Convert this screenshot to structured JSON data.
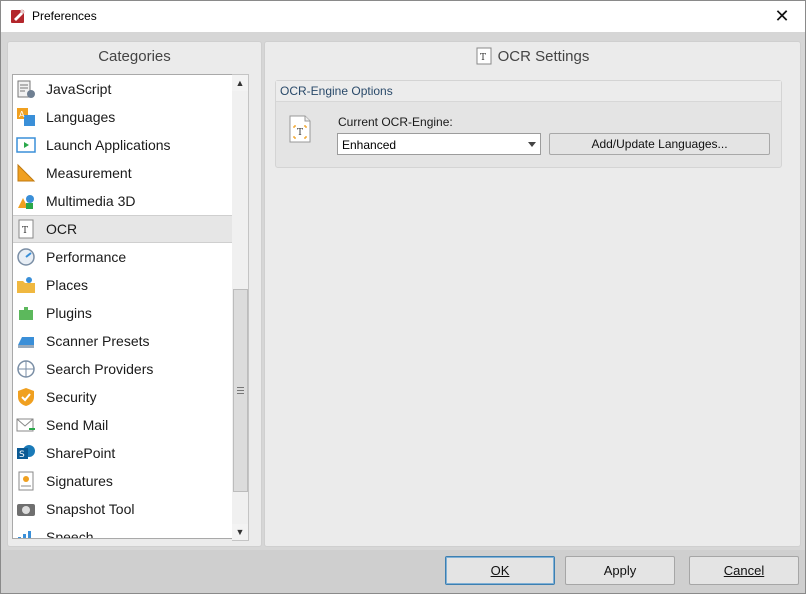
{
  "window": {
    "title": "Preferences",
    "close_glyph": "✕"
  },
  "categories": {
    "header": "Categories",
    "items": [
      {
        "label": "JavaScript",
        "icon": "javascript-icon"
      },
      {
        "label": "Languages",
        "icon": "languages-icon"
      },
      {
        "label": "Launch Applications",
        "icon": "launch-applications-icon"
      },
      {
        "label": "Measurement",
        "icon": "measurement-icon"
      },
      {
        "label": "Multimedia 3D",
        "icon": "multimedia-3d-icon"
      },
      {
        "label": "OCR",
        "icon": "ocr-icon",
        "selected": true
      },
      {
        "label": "Performance",
        "icon": "performance-icon"
      },
      {
        "label": "Places",
        "icon": "places-icon"
      },
      {
        "label": "Plugins",
        "icon": "plugins-icon"
      },
      {
        "label": "Scanner Presets",
        "icon": "scanner-presets-icon"
      },
      {
        "label": "Search Providers",
        "icon": "search-providers-icon"
      },
      {
        "label": "Security",
        "icon": "security-icon"
      },
      {
        "label": "Send Mail",
        "icon": "send-mail-icon"
      },
      {
        "label": "SharePoint",
        "icon": "sharepoint-icon"
      },
      {
        "label": "Signatures",
        "icon": "signatures-icon"
      },
      {
        "label": "Snapshot Tool",
        "icon": "snapshot-tool-icon"
      },
      {
        "label": "Speech",
        "icon": "speech-icon"
      }
    ]
  },
  "settings": {
    "title": "OCR Settings",
    "group_title": "OCR-Engine Options",
    "engine_label": "Current OCR-Engine:",
    "engine_value": "Enhanced",
    "add_languages_label": "Add/Update Languages..."
  },
  "buttons": {
    "ok_label": "OK",
    "apply_label": "Apply",
    "cancel_label": "Cancel"
  },
  "colors": {
    "accent": "#3c7fb1",
    "selected_row": "#e6e6e6"
  }
}
